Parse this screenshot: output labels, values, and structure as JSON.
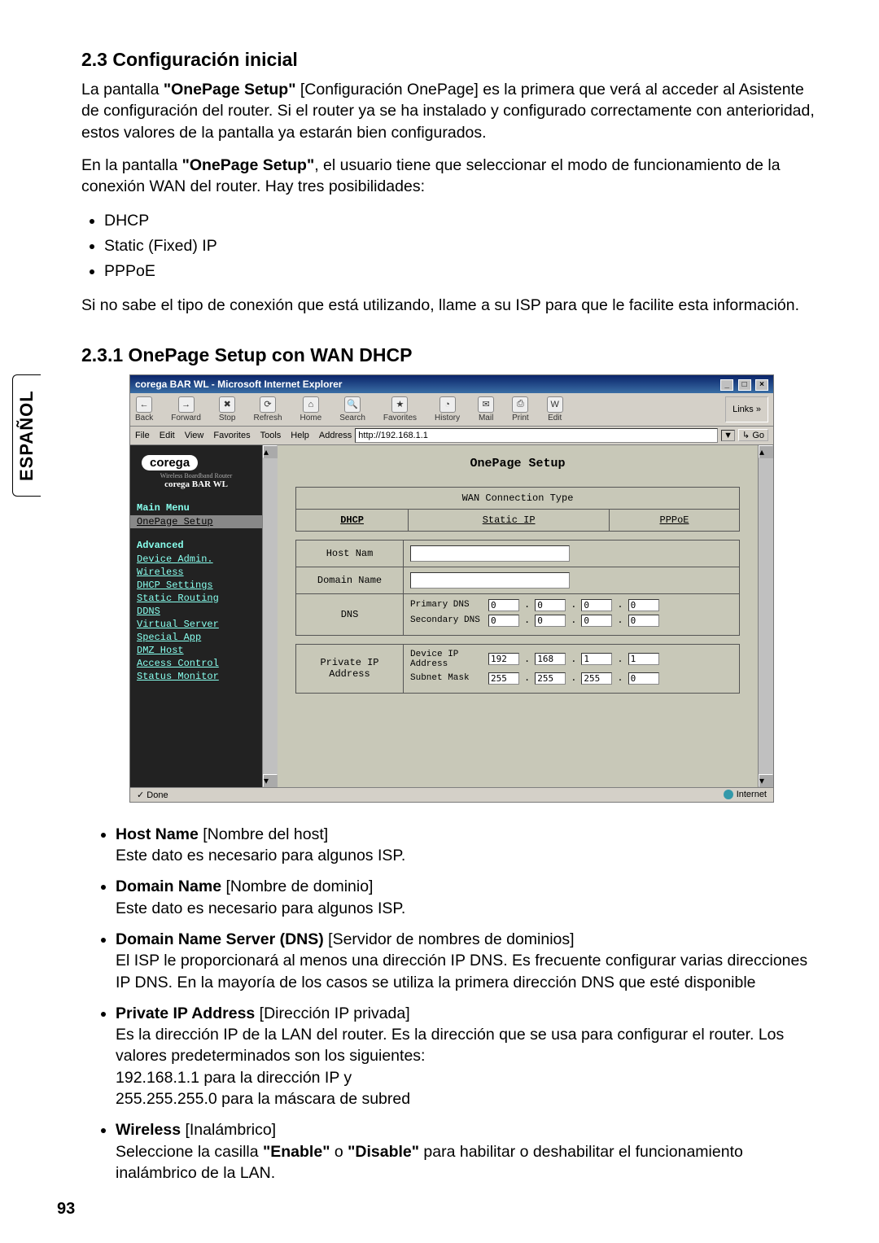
{
  "side_tab": "ESPAÑOL",
  "page_number": "93",
  "section_2_3": {
    "heading": "2.3 Configuración inicial",
    "p1_a": "La pantalla ",
    "p1_b": "\"OnePage Setup\"",
    "p1_c": " [Configuración OnePage] es la primera que verá al acceder al Asistente de configuración del router. Si el router ya se ha instalado y configurado correctamente con anterioridad, estos valores de la pantalla ya estarán bien configurados.",
    "p2_a": "En la pantalla ",
    "p2_b": "\"OnePage Setup\"",
    "p2_c": ", el usuario tiene que seleccionar el modo de funcionamiento de la conexión WAN del router. Hay tres posibilidades:",
    "bullets": [
      "DHCP",
      "Static (Fixed) IP",
      "PPPoE"
    ],
    "p3": "Si no sabe el tipo de conexión que está utilizando, llame a su ISP para que le facilite esta información."
  },
  "section_2_3_1": {
    "heading": "2.3.1 OnePage Setup con WAN DHCP"
  },
  "screenshot": {
    "title": "corega BAR WL - Microsoft Internet Explorer",
    "toolbar": {
      "back": "Back",
      "forward": "Forward",
      "stop": "Stop",
      "refresh": "Refresh",
      "home": "Home",
      "search": "Search",
      "favorites": "Favorites",
      "history": "History",
      "mail": "Mail",
      "print": "Print",
      "edit": "Edit",
      "links": "Links"
    },
    "menubar": {
      "file": "File",
      "edit": "Edit",
      "view": "View",
      "favorites": "Favorites",
      "tools": "Tools",
      "help": "Help"
    },
    "address_label": "Address",
    "address_value": "http://192.168.1.1",
    "go": "Go",
    "sidebar": {
      "brand": "corega",
      "sub": "Wireless Boardband Router",
      "product": "corega BAR WL",
      "main_menu_label": "Main Menu",
      "advanced_label": "Advanced",
      "items": {
        "onepage": "OnePage Setup",
        "device_admin": "Device Admin.",
        "wireless": "Wireless",
        "dhcp_settings": "DHCP Settings",
        "static_routing": "Static Routing",
        "ddns": "DDNS",
        "virtual_server": "Virtual Server",
        "special_app": "Special App",
        "dmz_host": "DMZ Host",
        "access_control": "Access Control",
        "status_monitor": "Status Monitor"
      }
    },
    "setup": {
      "title": "OnePage Setup",
      "wan_conn_type": "WAN Connection Type",
      "tabs": {
        "dhcp": "DHCP",
        "static_ip": "Static IP",
        "pppoe": "PPPoE"
      },
      "host_name": "Host Nam",
      "domain_name": "Domain Name",
      "dns": "DNS",
      "primary_dns": "Primary DNS",
      "secondary_dns": "Secondary DNS",
      "private_ip_address": "Private IP Address",
      "device_ip_address": "Device IP Address",
      "subnet_mask": "Subnet Mask",
      "device_ip_octets": [
        "192",
        "168",
        "1",
        "1"
      ],
      "subnet_octets": [
        "255",
        "255",
        "255",
        "0"
      ],
      "dns_zero": "0"
    },
    "statusbar": {
      "done": "Done",
      "zone": "Internet"
    }
  },
  "fields": {
    "hostname": {
      "term": "Host Name",
      "hint": " [Nombre del host]",
      "expl": "Este dato es necesario para algunos ISP."
    },
    "domainname": {
      "term": "Domain Name",
      "hint": " [Nombre de dominio]",
      "expl": "Este dato es necesario para algunos ISP."
    },
    "dns": {
      "term": "Domain Name Server (DNS)",
      "hint": " [Servidor de nombres de dominios]",
      "expl": "El ISP le proporcionará al menos una dirección IP DNS. Es frecuente configurar varias direcciones IP DNS. En la mayoría de los casos se utiliza la primera dirección DNS que esté disponible"
    },
    "privateip": {
      "term": "Private IP Address",
      "hint": " [Dirección IP privada]",
      "expl": "Es la dirección IP de la LAN del router. Es la dirección que se usa para configurar el router. Los valores predeterminados son los siguientes:",
      "sub1": "192.168.1.1 para la dirección IP y",
      "sub2": "255.255.255.0 para la máscara de subred"
    },
    "wireless": {
      "term": "Wireless",
      "hint": " [Inalámbrico]",
      "expl_a": "Seleccione la casilla ",
      "expl_b": "\"Enable\"",
      "expl_c": " o ",
      "expl_d": "\"Disable\"",
      "expl_e": " para habilitar o deshabilitar el funcionamiento inalámbrico de la LAN."
    }
  }
}
